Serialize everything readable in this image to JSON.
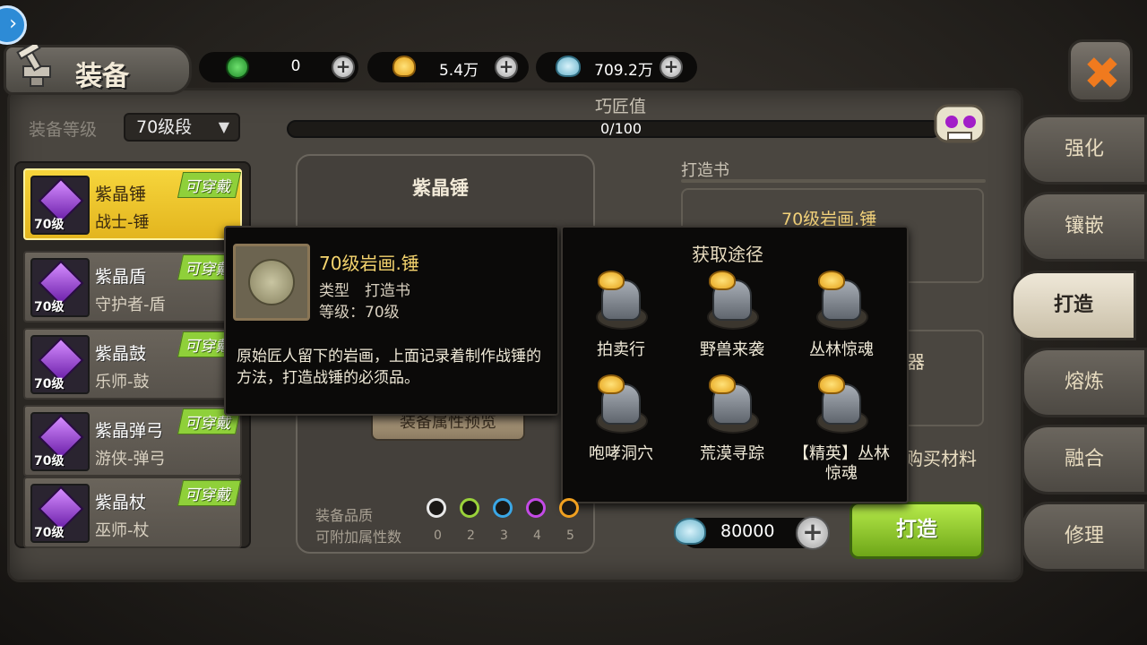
{
  "header": {
    "title": "装备",
    "currencies": [
      {
        "icon": "green-gem-icon",
        "value": "0"
      },
      {
        "icon": "gold-shell-icon",
        "value": "5.4万"
      },
      {
        "icon": "blue-shell-icon",
        "value": "709.2万"
      }
    ],
    "plus": "+",
    "close": "✖",
    "back": "›"
  },
  "filter": {
    "label": "装备等级",
    "selected": "70级段",
    "arrow": "▼"
  },
  "items": [
    {
      "name": "紫晶锤",
      "cls": "战士-锤",
      "level": "70级",
      "badge": "可穿戴",
      "selected": true
    },
    {
      "name": "紫晶盾",
      "cls": "守护者-盾",
      "level": "70级",
      "badge": "可穿戴",
      "selected": false
    },
    {
      "name": "紫晶鼓",
      "cls": "乐师-鼓",
      "level": "70级",
      "badge": "可穿戴",
      "selected": false
    },
    {
      "name": "紫晶弹弓",
      "cls": "游侠-弹弓",
      "level": "70级",
      "badge": "可穿戴",
      "selected": false
    },
    {
      "name": "紫晶杖",
      "cls": "巫师-杖",
      "level": "70级",
      "badge": "可穿戴",
      "selected": false
    }
  ],
  "skill": {
    "label": "巧匠值",
    "value": "0/100",
    "progress": 0
  },
  "center": {
    "title": "紫晶锤",
    "preview": "装备属性预览",
    "quality_label": "装备品质",
    "attr_label": "可附加属性数",
    "quality_colors": [
      "#e8e8e8",
      "#9ad23a",
      "#3aa7e6",
      "#c44ae6",
      "#f0a020"
    ],
    "quality_nums": [
      "0",
      "2",
      "3",
      "4",
      "5"
    ]
  },
  "right": {
    "book_label": "打造书",
    "book_name": "70级岩画.锤",
    "material_name": "制器",
    "buy_text": "自动购买材料",
    "cost": "80000",
    "forge": "打造"
  },
  "tabs": [
    "强化",
    "镶嵌",
    "打造",
    "熔炼",
    "融合",
    "修理"
  ],
  "active_tab": "打造",
  "tooltip": {
    "title": "70级岩画.锤",
    "type": "类型　打造书",
    "level": "等级：70级",
    "desc": "原始匠人留下的岩画，上面记录着制作战锤的方法，打造战锤的必须品。"
  },
  "sources": {
    "title": "获取途径",
    "items": [
      "拍卖行",
      "野兽来袭",
      "丛林惊魂",
      "咆哮洞穴",
      "荒漠寻踪",
      "【精英】丛林惊魂"
    ]
  }
}
